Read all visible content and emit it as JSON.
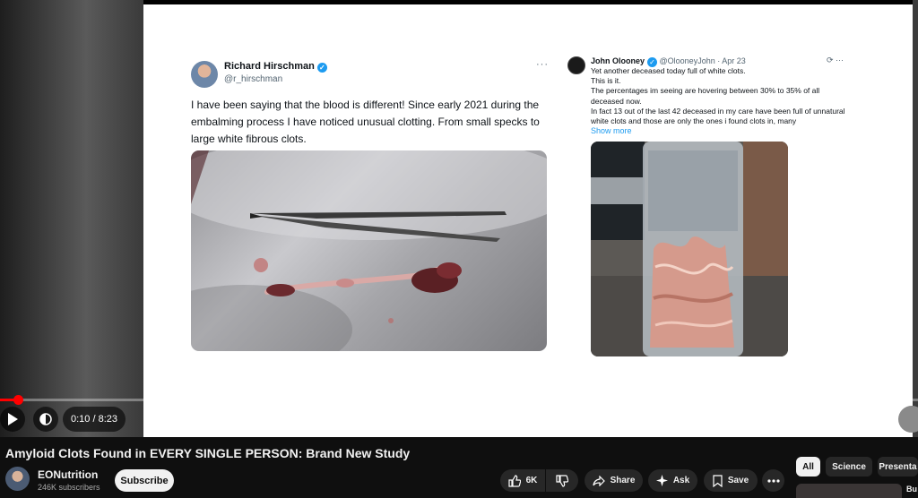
{
  "video": {
    "tweet_left": {
      "name": "Richard Hirschman",
      "handle": "@r_hirschman",
      "more": "···",
      "text": "I have been saying that the blood is different! Since early 2021 during the embalming process I have noticed unusual clotting. From small specks to large white fibrous clots."
    },
    "tweet_right": {
      "name": "John Olooney",
      "handle_date": "@OlooneyJohn · Apr 23",
      "icons": "⟳ ···",
      "lines": [
        "Yet another deceased today full of white clots.",
        "This is it.",
        "The percentages im seeing are hovering between 30% to 35% of all",
        "deceased now.",
        "In fact 13 out of the last 42 deceased in my care have been full of unnatural",
        "white clots and those are only the ones i found clots in, many"
      ],
      "show_more": "Show more"
    }
  },
  "player": {
    "progress_fraction": 0.02,
    "time": "0:10 / 8:23",
    "accent": "#ff0000"
  },
  "meta": {
    "title": "Amyloid Clots Found in EVERY SINGLE PERSON: Brand New Study",
    "channel": "EONutrition",
    "subscribers": "246K subscribers",
    "subscribe_label": "Subscribe",
    "like_count": "6K",
    "share_label": "Share",
    "ask_label": "Ask",
    "save_label": "Save"
  },
  "chips": [
    "All",
    "Science",
    "Presenta"
  ],
  "recommendation": {
    "title_fragment": "Bu"
  }
}
